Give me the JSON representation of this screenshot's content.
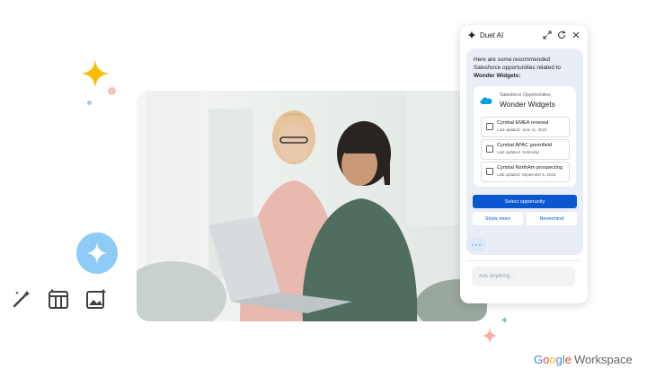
{
  "colors": {
    "accent": "#0b57d0",
    "panel_bg": "#e9eef6",
    "spark_yellow": "#fbbc04",
    "spark_pink": "#f6aea9",
    "spark_green": "#81c995",
    "assist_blue": "#8ecbf7"
  },
  "icons": {
    "panel_logo": "sparkle-icon",
    "expand": "expand-icon",
    "refresh": "refresh-icon",
    "close": "close-icon",
    "salesforce": "salesforce-cloud-icon",
    "tool_1": "magic-pen-icon",
    "tool_2": "table-icon",
    "tool_3": "image-sparkle-icon"
  },
  "panel": {
    "title": "Duet AI",
    "intro_text": "Here are some recommended Salesforce opportunities related to ",
    "intro_bold": "Wonder Widgets:",
    "card": {
      "source": "Salesforce Opportunities",
      "name": "Wonder Widgets",
      "options": [
        {
          "name": "Cymbal EMEA renewal",
          "updated": "Last updated: June 11, 2023"
        },
        {
          "name": "Cymbal APAC greenfield",
          "updated": "Last updated: Yesterday"
        },
        {
          "name": "Cymbal NorthAm prospecting",
          "updated": "Last updated: September 5, 2019"
        }
      ]
    },
    "select_label": "Select opportunity",
    "show_more_label": "Show more",
    "nevermind_label": "Nevermind",
    "input_placeholder": "Ask anything..."
  },
  "brand": {
    "g": "G",
    "o1": "o",
    "o2": "o",
    "g2": "g",
    "l": "l",
    "e": "e",
    "product": "Workspace"
  }
}
